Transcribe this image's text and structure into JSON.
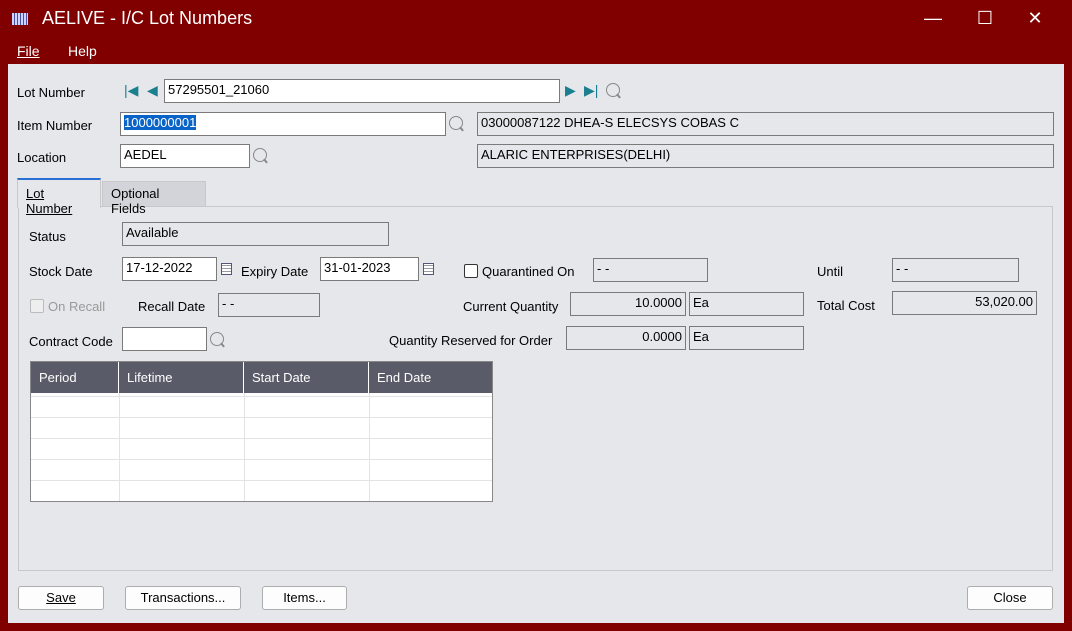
{
  "window": {
    "title": "AELIVE - I/C Lot Numbers",
    "minimize": "—",
    "maximize": "☐",
    "close": "✕"
  },
  "menu": [
    "File",
    "Help"
  ],
  "header": {
    "lot_number_label": "Lot Number",
    "lot_number": "57295501_21060",
    "item_number_label": "Item Number",
    "item_number": "1000000001",
    "item_description": "03000087122 DHEA-S ELECSYS COBAS C",
    "location_label": "Location",
    "location": "AEDEL",
    "location_description": "ALARIC ENTERPRISES(DELHI)"
  },
  "tabs": [
    "Lot Number",
    "Optional Fields"
  ],
  "form": {
    "status_label": "Status",
    "status": "Available",
    "stock_date_label": "Stock Date",
    "stock_date": "17-12-2022",
    "expiry_date_label": "Expiry Date",
    "expiry_date": "31-01-2023",
    "quarantined_label": "Quarantined On",
    "quarantined_on": "-  -",
    "until_label": "Until",
    "until": "-  -",
    "on_recall_label": "On Recall",
    "recall_date_label": "Recall Date",
    "recall_date": "-  -",
    "current_qty_label": "Current Quantity",
    "current_qty": "10.0000",
    "current_qty_uom": "Ea",
    "total_cost_label": "Total Cost",
    "total_cost": "53,020.00",
    "contract_code_label": "Contract Code",
    "contract_code": "",
    "reserved_label": "Quantity Reserved for Order",
    "reserved_qty": "0.0000",
    "reserved_uom": "Ea"
  },
  "grid": {
    "columns": [
      "Period",
      "Lifetime",
      "Start Date",
      "End Date"
    ]
  },
  "buttons": {
    "save": "Save",
    "transactions": "Transactions...",
    "items": "Items...",
    "close": "Close"
  }
}
